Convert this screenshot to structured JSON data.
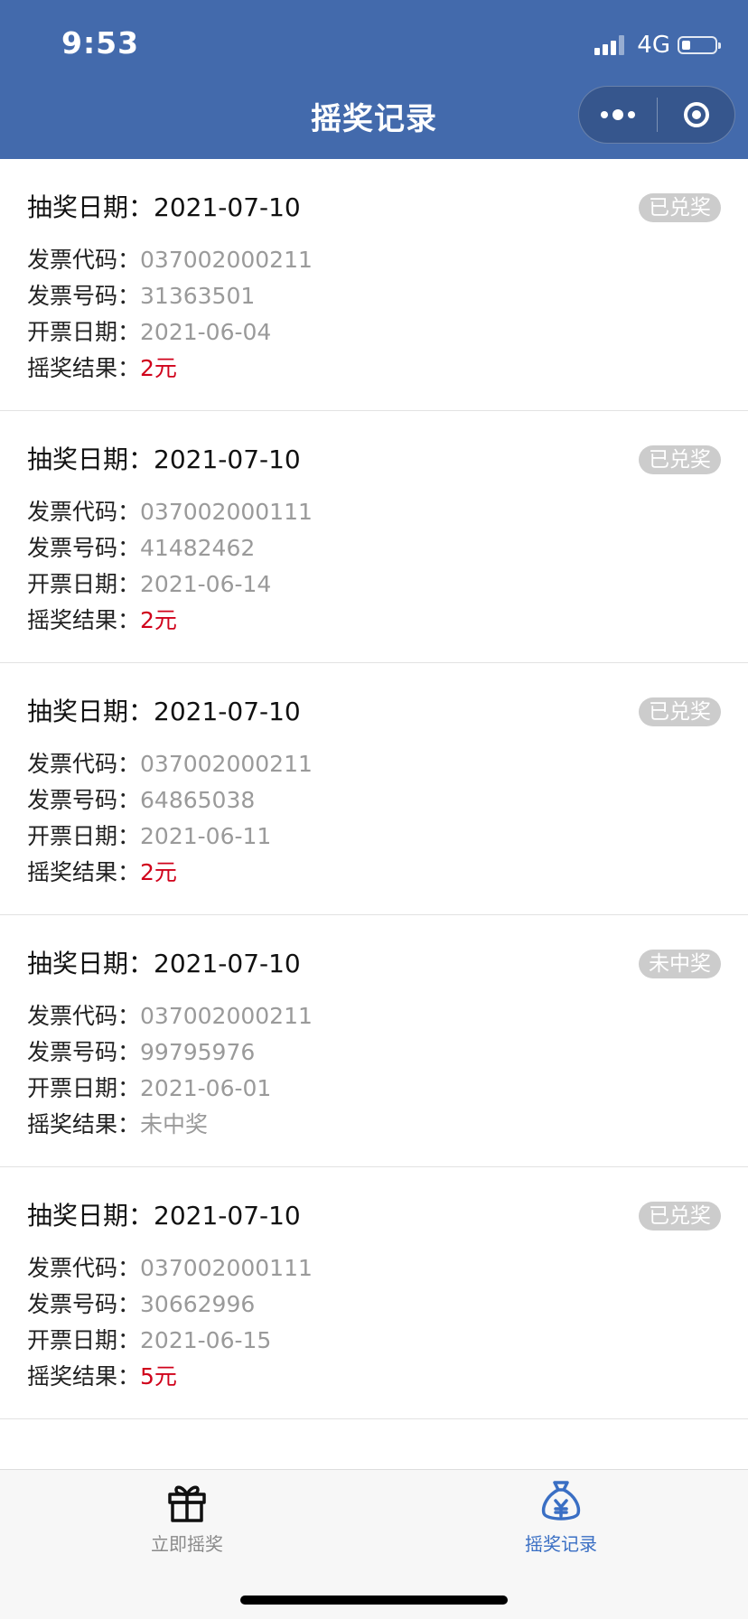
{
  "status_bar": {
    "time": "9:53",
    "network": "4G",
    "battery_level": 0.25
  },
  "nav": {
    "title": "摇奖记录"
  },
  "labels": {
    "draw_date": "抽奖日期：",
    "invoice_code": "发票代码：",
    "invoice_number": "发票号码：",
    "issue_date": "开票日期：",
    "result": "摇奖结果："
  },
  "records": [
    {
      "draw_date": "2021-07-10",
      "status": "已兑奖",
      "invoice_code": "037002000211",
      "invoice_number": "31363501",
      "issue_date": "2021-06-04",
      "result": "2元"
    },
    {
      "draw_date": "2021-07-10",
      "status": "已兑奖",
      "invoice_code": "037002000111",
      "invoice_number": "41482462",
      "issue_date": "2021-06-14",
      "result": "2元"
    },
    {
      "draw_date": "2021-07-10",
      "status": "已兑奖",
      "invoice_code": "037002000211",
      "invoice_number": "64865038",
      "issue_date": "2021-06-11",
      "result": "2元"
    },
    {
      "draw_date": "2021-07-10",
      "status": "未中奖",
      "invoice_code": "037002000211",
      "invoice_number": "99795976",
      "issue_date": "2021-06-01",
      "result": "未中奖"
    },
    {
      "draw_date": "2021-07-10",
      "status": "已兑奖",
      "invoice_code": "037002000111",
      "invoice_number": "30662996",
      "issue_date": "2021-06-15",
      "result": "5元"
    }
  ],
  "tabbar": {
    "tabs": [
      {
        "label": "立即摇奖",
        "icon": "gift-icon",
        "active": false
      },
      {
        "label": "摇奖记录",
        "icon": "money-bag-icon",
        "active": true
      }
    ]
  },
  "colors": {
    "header_bg": "#436aac",
    "win": "#d0021b",
    "muted": "#9a9a9a",
    "badge_bg": "#cccccc",
    "active_tab": "#3a6fc4"
  }
}
